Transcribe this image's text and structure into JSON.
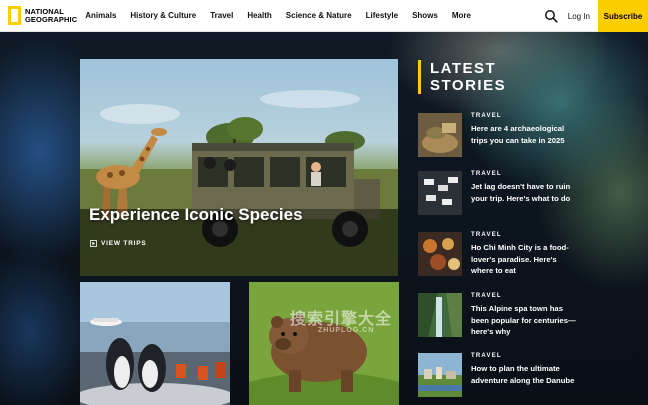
{
  "header": {
    "logo_line1": "National",
    "logo_line2": "Geographic",
    "nav": [
      "Animals",
      "History & Culture",
      "Travel",
      "Health",
      "Science & Nature",
      "Lifestyle",
      "Shows",
      "More"
    ],
    "login_label": "Log In",
    "subscribe_label": "Subscribe"
  },
  "hero": {
    "title": "Experience Iconic Species",
    "link_label": "VIEW TRIPS"
  },
  "latest": {
    "title_line1": "LATEST",
    "title_line2": "STORIES",
    "stories": [
      {
        "kicker": "TRAVEL",
        "headline": "Here are 4 archaeological trips you can take in 2025"
      },
      {
        "kicker": "TRAVEL",
        "headline": "Jet lag doesn't have to ruin your trip. Here's what to do"
      },
      {
        "kicker": "TRAVEL",
        "headline": "Ho Chi Minh City is a food-lover's paradise. Here's where to eat"
      },
      {
        "kicker": "TRAVEL",
        "headline": "This Alpine spa town has been popular for centuries—here's why"
      },
      {
        "kicker": "TRAVEL",
        "headline": "How to plan the ultimate adventure along the Danube"
      }
    ]
  },
  "watermark": {
    "text": "搜索引擎大全",
    "sub": "ZHUPLOG.CN"
  },
  "colors": {
    "accent": "#ffce00",
    "header_bg": "#ffffff",
    "page_bg": "#0b0f14"
  },
  "icons": {
    "search": "search-icon",
    "play": "play-icon"
  }
}
